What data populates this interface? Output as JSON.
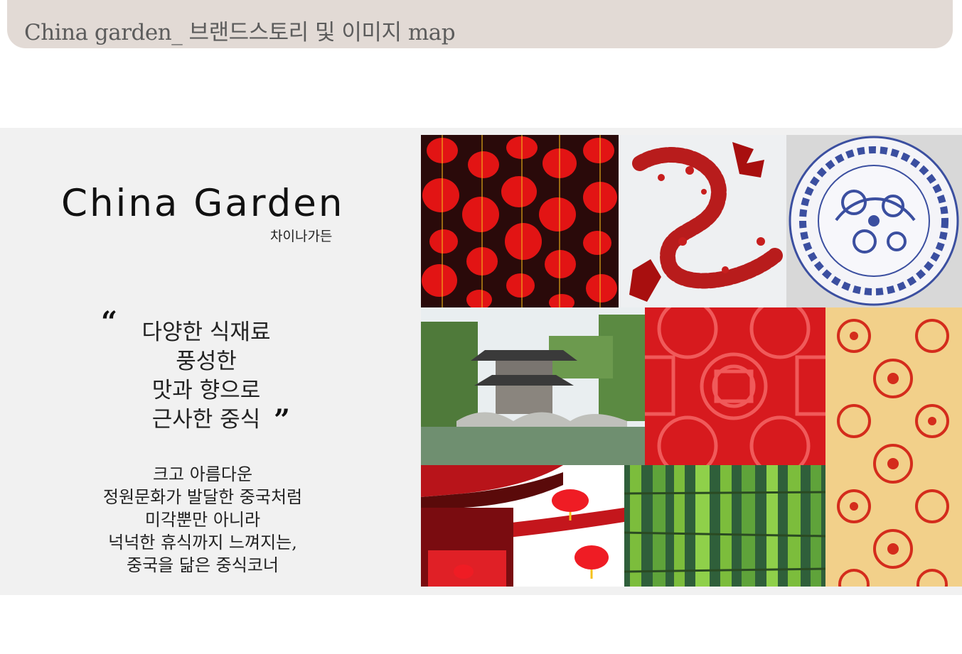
{
  "header": {
    "title": "China garden_ 브랜드스토리 및 이미지 map"
  },
  "brand": {
    "name": "China Garden",
    "korean_name": "차이나가든",
    "quote_lines": [
      "다양한 식재료",
      "풍성한",
      "맛과 향으로",
      "근사한 중식"
    ],
    "quote_open": "“",
    "quote_close": "”",
    "description_lines": [
      "크고 아름다운",
      "정원문화가 발달한 중국처럼",
      "미각뿐만 아니라",
      "넉넉한 휴식까지 느껴지는,",
      "중국을 닮은 중식코너"
    ]
  },
  "colors": {
    "header_bg": "#e2dad5",
    "band_bg": "#f1f1f1",
    "lantern_red": "#e01010",
    "porcelain_blue": "#3b4fa0",
    "pattern_gold": "#f2d08a"
  },
  "images": [
    {
      "name": "red-lanterns-image"
    },
    {
      "name": "red-dragon-image"
    },
    {
      "name": "blue-porcelain-plate-image"
    },
    {
      "name": "chinese-garden-pavilion-image"
    },
    {
      "name": "red-knot-pattern-image"
    },
    {
      "name": "gold-red-floral-pattern-image"
    },
    {
      "name": "red-chinese-roof-image"
    },
    {
      "name": "green-bamboo-image"
    }
  ]
}
